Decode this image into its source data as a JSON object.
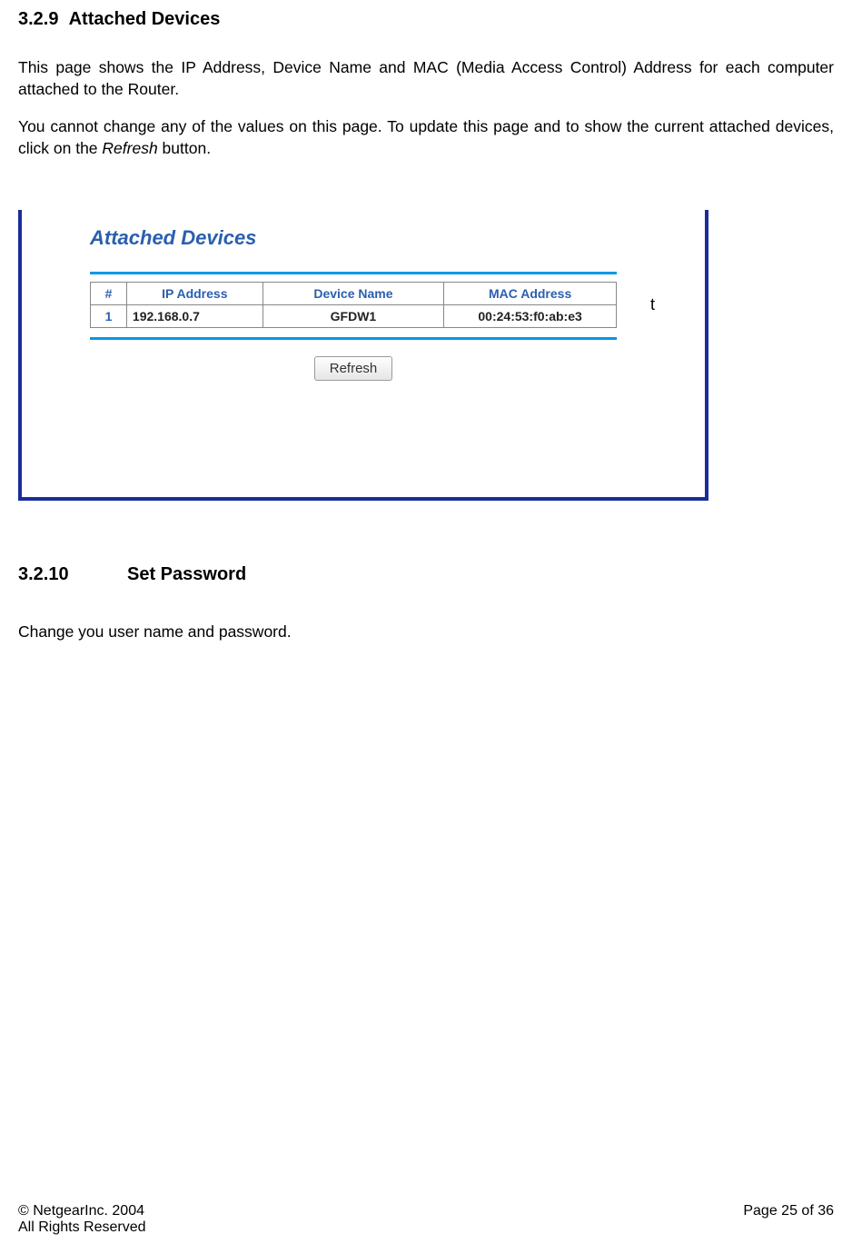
{
  "section1": {
    "number": "3.2.9",
    "title": "Attached Devices",
    "para1": "This page shows the IP Address, Device Name and MAC (Media Access Control) Address for each computer attached to the Router.",
    "para2_a": "You cannot change any of the values on this page. To update this page and to show the current attached devices, click on the ",
    "para2_i": "Refresh",
    "para2_b": " button."
  },
  "panel": {
    "title": "Attached Devices",
    "headers": {
      "num": "#",
      "ip": "IP Address",
      "name": "Device Name",
      "mac": "MAC Address"
    },
    "rows": [
      {
        "num": "1",
        "ip": "192.168.0.7",
        "name": "GFDW1",
        "mac": "00:24:53:f0:ab:e3"
      }
    ],
    "refresh": "Refresh",
    "stray": "t"
  },
  "section2": {
    "number": "3.2.10",
    "title": "Set Password",
    "para": "Change you user name and password."
  },
  "footer": {
    "left1": "© NetgearInc. 2004",
    "left2": "All Rights Reserved",
    "right": "Page 25 of 36"
  }
}
